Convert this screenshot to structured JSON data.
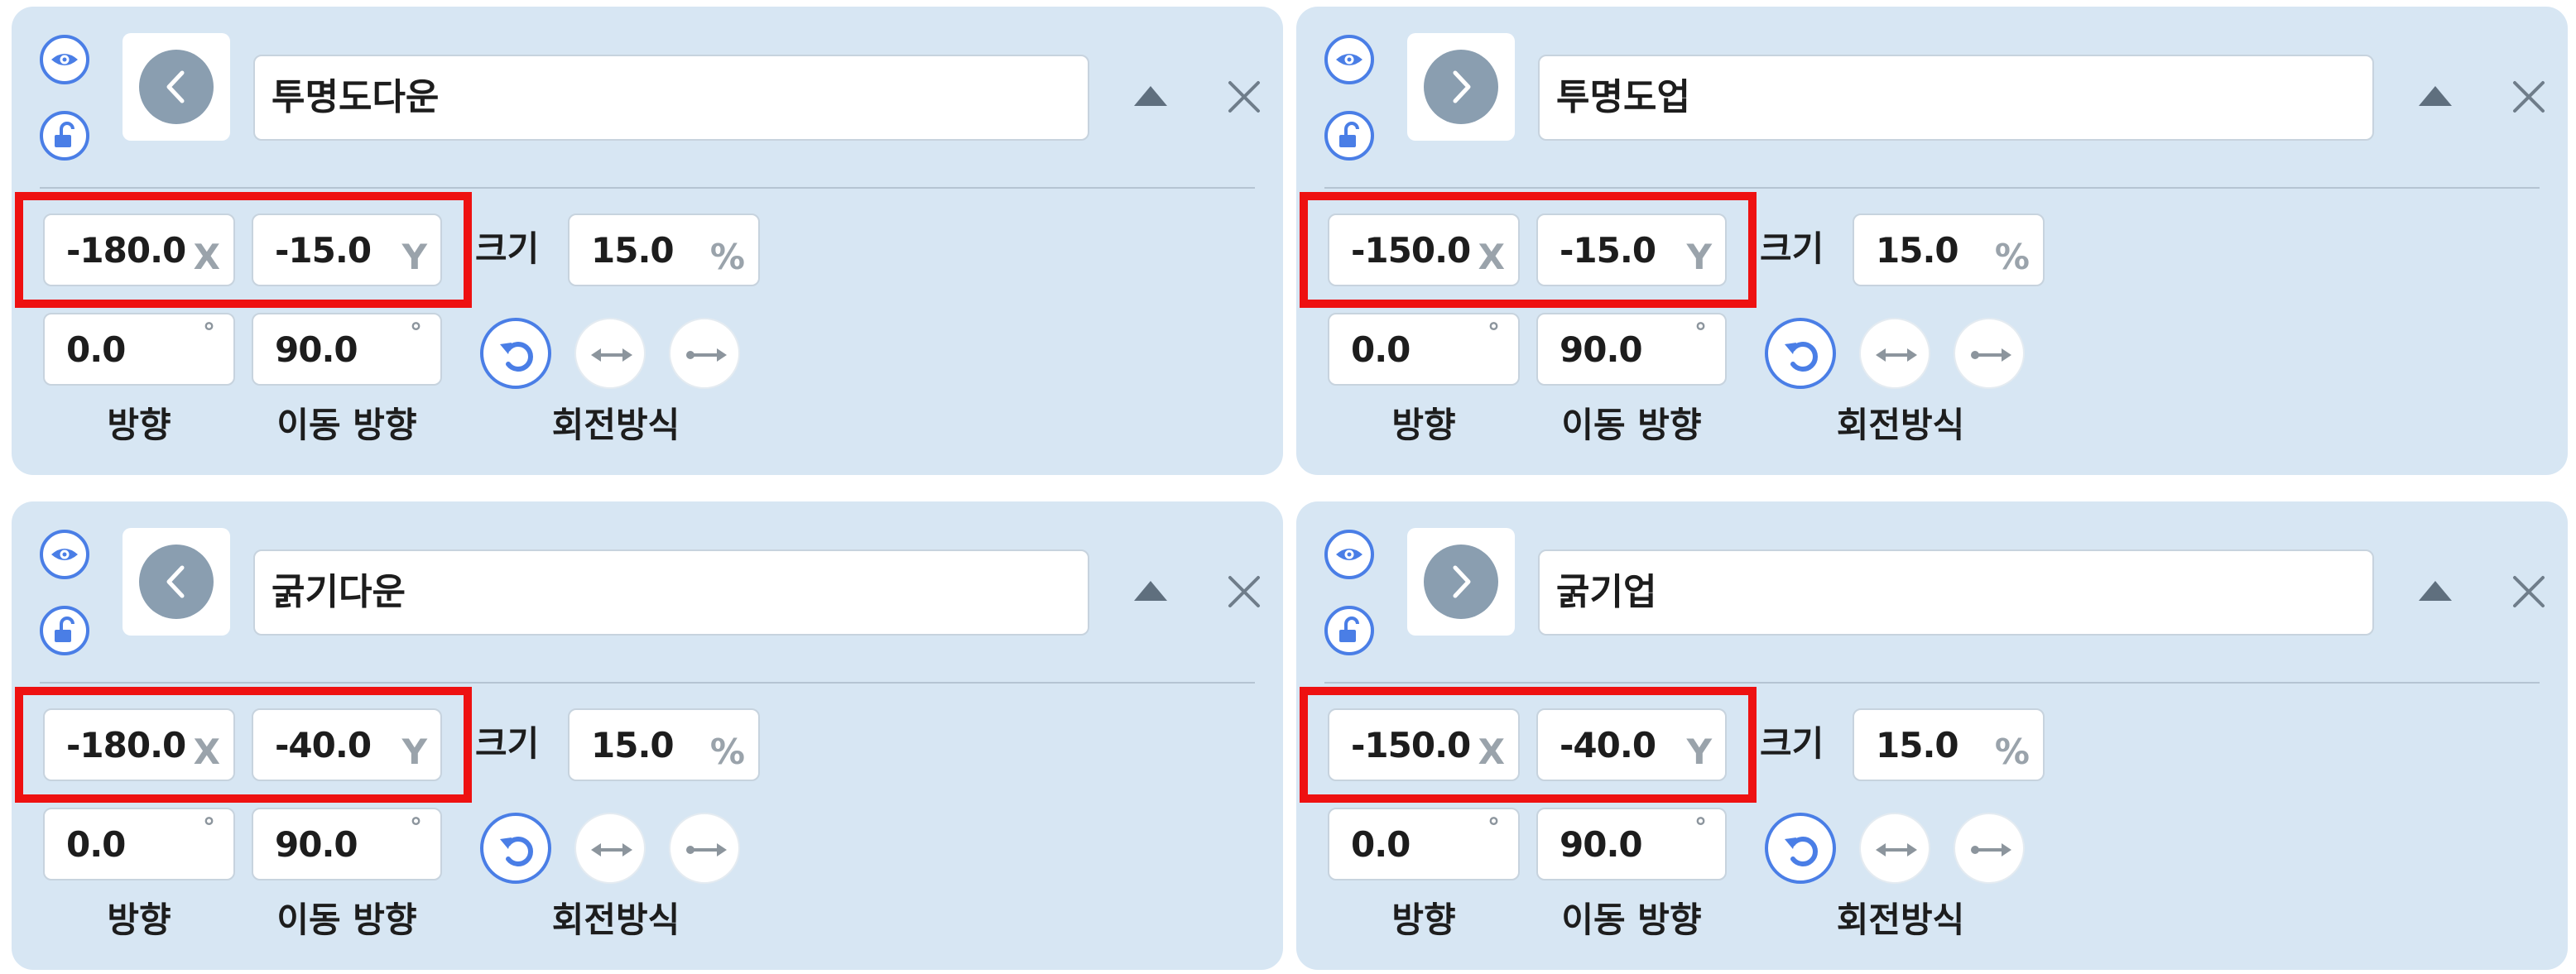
{
  "panels": [
    {
      "name": "투명도다운",
      "arrow": "chevron-left-icon",
      "x": "-180.0",
      "y": "-15.0",
      "size": "15.0",
      "direction": "0.0",
      "move_direction": "90.0"
    },
    {
      "name": "투명도업",
      "arrow": "chevron-right-icon",
      "x": "-150.0",
      "y": "-15.0",
      "size": "15.0",
      "direction": "0.0",
      "move_direction": "90.0"
    },
    {
      "name": "굵기다운",
      "arrow": "chevron-left-icon",
      "x": "-180.0",
      "y": "-40.0",
      "size": "15.0",
      "direction": "0.0",
      "move_direction": "90.0"
    },
    {
      "name": "굵기업",
      "arrow": "chevron-right-icon",
      "x": "-150.0",
      "y": "-40.0",
      "size": "15.0",
      "direction": "0.0",
      "move_direction": "90.0"
    }
  ],
  "labels": {
    "x_unit": "X",
    "y_unit": "Y",
    "size": "크기",
    "percent": "%",
    "degree": "°",
    "direction": "방향",
    "move_direction": "이동 방향",
    "rotation_mode": "회전방식"
  },
  "icons": {
    "visibility": "eye-icon",
    "lock": "unlock-icon",
    "expand": "triangle-up-icon",
    "close": "close-icon",
    "rotation_free": "rotate-icon",
    "rotation_flip": "arrows-horizontal-icon",
    "rotation_none": "arrow-right-icon"
  },
  "colors": {
    "panel_bg": "#d7e6f3",
    "accent": "#4a7ee6",
    "highlight": "#ee1111",
    "thumb_disc": "#8a9eb0"
  }
}
